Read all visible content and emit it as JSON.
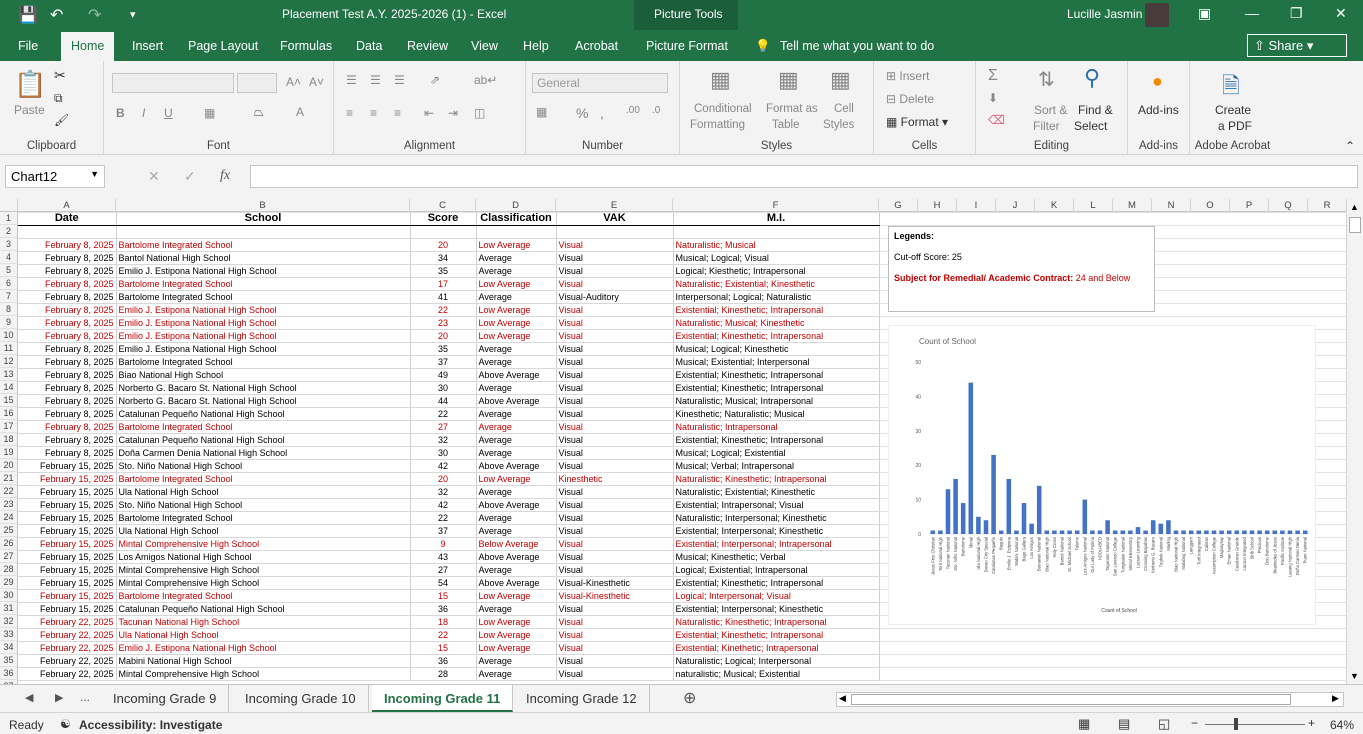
{
  "window": {
    "title": "Placement Test A.Y. 2025-2026 (1)  -  Excel",
    "context_tab": "Picture Tools",
    "user": "Lucille Jasmin"
  },
  "ribbon_tabs": [
    "File",
    "Home",
    "Insert",
    "Page Layout",
    "Formulas",
    "Data",
    "Review",
    "View",
    "Help",
    "Acrobat",
    "Picture Format"
  ],
  "tell_me": "Tell me what you want to do",
  "share_label": "Share",
  "ribbon": {
    "clipboard": {
      "label": "Clipboard",
      "paste": "Paste"
    },
    "font": {
      "label": "Font"
    },
    "alignment": {
      "label": "Alignment"
    },
    "number": {
      "label": "Number",
      "format": "General"
    },
    "styles": {
      "label": "Styles",
      "conditional": "Conditional",
      "formatting": "Formatting",
      "format_as": "Format as",
      "table": "Table",
      "cell": "Cell",
      "cell_styles": "Styles"
    },
    "cells": {
      "label": "Cells",
      "insert": "Insert",
      "delete": "Delete",
      "format": "Format"
    },
    "editing": {
      "label": "Editing",
      "sort": "Sort &",
      "filter": "Filter",
      "find": "Find &",
      "select": "Select"
    },
    "addins": {
      "label": "Add-ins",
      "btn": "Add-ins"
    },
    "acrobat": {
      "label": "Adobe Acrobat",
      "create": "Create",
      "pdf": "a PDF"
    }
  },
  "formula_bar": {
    "name_box": "Chart12",
    "fx": "fx",
    "value": ""
  },
  "columns": [
    "A",
    "B",
    "C",
    "D",
    "E",
    "F",
    "G",
    "H",
    "I",
    "J",
    "K",
    "L",
    "M",
    "N",
    "O",
    "P",
    "Q",
    "R"
  ],
  "headers": [
    "Date",
    "School",
    "Score",
    "Classification",
    "VAK",
    "M.I."
  ],
  "rows": [
    {
      "n": 3,
      "red": true,
      "d": "February 8, 2025",
      "s": "Bartolome Integrated School",
      "sc": "20",
      "c": "Low Average",
      "v": "Visual",
      "m": "Naturalistic; Musical"
    },
    {
      "n": 4,
      "red": false,
      "d": "February 8, 2025",
      "s": "Bantol National High School",
      "sc": "34",
      "c": "Average",
      "v": "Visual",
      "m": "Musical; Logical; Visual"
    },
    {
      "n": 5,
      "red": false,
      "d": "February 8, 2025",
      "s": "Emilio J. Estipona National High School",
      "sc": "35",
      "c": "Average",
      "v": "Visual",
      "m": "Logical; Kiesthetic; Intrapersonal"
    },
    {
      "n": 6,
      "red": true,
      "d": "February 8, 2025",
      "s": "Bartolome Integrated School",
      "sc": "17",
      "c": "Low Average",
      "v": "Visual",
      "m": "Naturalistic; Existential; Kinesthetic"
    },
    {
      "n": 7,
      "red": false,
      "d": "February 8, 2025",
      "s": "Bartolome Integrated School",
      "sc": "41",
      "c": "Average",
      "v": "Visual-Auditory",
      "m": "Interpersonal; Logical; Naturalistic"
    },
    {
      "n": 8,
      "red": true,
      "d": "February 8, 2025",
      "s": "Emilio J. Estipona National High School",
      "sc": "22",
      "c": "Low Average",
      "v": "Visual",
      "m": "Existential; Kinesthetic; Intrapersonal"
    },
    {
      "n": 9,
      "red": true,
      "d": "February 8, 2025",
      "s": "Emilio J. Estipona National High School",
      "sc": "23",
      "c": "Low Average",
      "v": "Visual",
      "m": "Naturalistic; Musical; Kinesthetic"
    },
    {
      "n": 10,
      "red": true,
      "d": "February 8, 2025",
      "s": "Emilio J. Estipona National High School",
      "sc": "20",
      "c": "Low Average",
      "v": "Visual",
      "m": "Existential; Kinesthetic; Intrapersonal"
    },
    {
      "n": 11,
      "red": false,
      "d": "February 8, 2025",
      "s": "Emilio J. Estipona National High School",
      "sc": "35",
      "c": "Average",
      "v": "Visual",
      "m": "Musical; Logical; Kinesthetic"
    },
    {
      "n": 12,
      "red": false,
      "d": "February 8, 2025",
      "s": "Bartolome Integrated School",
      "sc": "37",
      "c": "Average",
      "v": "Visual",
      "m": "Musical; Existential; Interpersonal"
    },
    {
      "n": 13,
      "red": false,
      "d": "February 8, 2025",
      "s": "Biao National High School",
      "sc": "49",
      "c": "Above Average",
      "v": "Visual",
      "m": "Existential; Kinesthetic; Intrapersonal"
    },
    {
      "n": 14,
      "red": false,
      "d": "February 8, 2025",
      "s": "Norberto G. Bacaro St. National High School",
      "sc": "30",
      "c": "Average",
      "v": "Visual",
      "m": "Existential; Kinesthetic; Intrapersonal"
    },
    {
      "n": 15,
      "red": false,
      "d": "February 8, 2025",
      "s": "Norberto G. Bacaro St. National High School",
      "sc": "44",
      "c": "Above Average",
      "v": "Visual",
      "m": "Naturalistic; Musical; Intrapersonal"
    },
    {
      "n": 16,
      "red": false,
      "d": "February 8, 2025",
      "s": "Catalunan Pequeño National High School",
      "sc": "22",
      "c": "Average",
      "v": "Visual",
      "m": "Kinesthetic; Naturalistic; Musical"
    },
    {
      "n": 17,
      "red": true,
      "d": "February 8, 2025",
      "s": "Bartolome Integrated School",
      "sc": "27",
      "c": "Average",
      "v": "Visual",
      "m": "Naturalistic; Intrapersonal"
    },
    {
      "n": 18,
      "red": false,
      "d": "February 8, 2025",
      "s": "Catalunan Pequeño National High School",
      "sc": "32",
      "c": "Average",
      "v": "Visual",
      "m": "Existential; Kinesthetic; Intrapersonal"
    },
    {
      "n": 19,
      "red": false,
      "d": "February 8, 2025",
      "s": "Doña Carmen Denia National High School",
      "sc": "30",
      "c": "Average",
      "v": "Visual",
      "m": "Musical; Logical; Existential"
    },
    {
      "n": 20,
      "red": false,
      "d": "February 15, 2025",
      "s": "Sto. Niño National High School",
      "sc": "42",
      "c": "Above Average",
      "v": "Visual",
      "m": "Musical; Verbal; Intrapersonal"
    },
    {
      "n": 21,
      "red": true,
      "d": "February 15, 2025",
      "s": "Bartolome Integrated School",
      "sc": "20",
      "c": "Low Average",
      "v": "Kinesthetic",
      "m": "Naturalistic; Kinesthetic; Intrapersonal"
    },
    {
      "n": 22,
      "red": false,
      "d": "February 15, 2025",
      "s": "Ula National High School",
      "sc": "32",
      "c": "Average",
      "v": "Visual",
      "m": "Naturalistic; Existential; Kinesthetic"
    },
    {
      "n": 23,
      "red": false,
      "d": "February 15, 2025",
      "s": "Sto. Niño National High School",
      "sc": "42",
      "c": "Above Average",
      "v": "Visual",
      "m": "Existential; Intrapersonal; Visual"
    },
    {
      "n": 24,
      "red": false,
      "d": "February 15, 2025",
      "s": "Bartolome Integrated School",
      "sc": "22",
      "c": "Average",
      "v": "Visual",
      "m": "Naturalistic; Interpersonal; Kinesthetic"
    },
    {
      "n": 25,
      "red": false,
      "d": "February 15, 2025",
      "s": "Ula National High School",
      "sc": "37",
      "c": "Average",
      "v": "Visual",
      "m": "Existential; Interpersonal; Kinesthetic"
    },
    {
      "n": 26,
      "red": true,
      "d": "February 15, 2025",
      "s": "Mintal Comprehensive High School",
      "sc": "9",
      "c": "Below Average",
      "v": "Visual",
      "m": "Existential; Interpersonal; Intrapersonal"
    },
    {
      "n": 27,
      "red": false,
      "d": "February 15, 2025",
      "s": "Los Amigos National High School",
      "sc": "43",
      "c": "Above Average",
      "v": "Visual",
      "m": "Musical; Kinesthetic; Verbal"
    },
    {
      "n": 28,
      "red": false,
      "d": "February 15, 2025",
      "s": "Mintal Comprehensive High School",
      "sc": "27",
      "c": "Average",
      "v": "Visual",
      "m": "Logical; Existential; Intrapersonal"
    },
    {
      "n": 29,
      "red": false,
      "d": "February 15, 2025",
      "s": "Mintal Comprehensive High School",
      "sc": "54",
      "c": "Above Average",
      "v": "Visual-Kinesthetic",
      "m": "Existential; Kinesthetic; Intrapersonal"
    },
    {
      "n": 30,
      "red": true,
      "d": "February 15, 2025",
      "s": "Bartolome Integrated School",
      "sc": "15",
      "c": "Low Average",
      "v": "Visual-Kinesthetic",
      "m": "Logical; Interpersonal; Visual"
    },
    {
      "n": 31,
      "red": false,
      "d": "February 15, 2025",
      "s": "Catalunan Pequeño National High School",
      "sc": "36",
      "c": "Average",
      "v": "Visual",
      "m": "Existential; Interpersonal; Kinesthetic"
    },
    {
      "n": 32,
      "red": true,
      "d": "February 22, 2025",
      "s": "Tacunan National High School",
      "sc": "18",
      "c": "Low Average",
      "v": "Visual",
      "m": "Naturalistic; Kinesthetic; Intrapersonal"
    },
    {
      "n": 33,
      "red": true,
      "d": "February 22, 2025",
      "s": "Ula National High School",
      "sc": "22",
      "c": "Low Average",
      "v": "Visual",
      "m": "Existential; Kinesthetic; Intrapersonal"
    },
    {
      "n": 34,
      "red": true,
      "d": "February 22, 2025",
      "s": "Emilio J. Estipona National High School",
      "sc": "15",
      "c": "Low Average",
      "v": "Visual",
      "m": "Existential; Kinethetic; Intrapersonal"
    },
    {
      "n": 35,
      "red": false,
      "d": "February 22, 2025",
      "s": "Mabini National High School",
      "sc": "36",
      "c": "Average",
      "v": "Visual",
      "m": "Naturalistic; Logical; Interpersonal"
    },
    {
      "n": 36,
      "red": false,
      "d": "February 22, 2025",
      "s": "Mintal Comprehensive High School",
      "sc": "28",
      "c": "Average",
      "v": "Visual",
      "m": "naturalistic; Musical; Existential"
    }
  ],
  "legend": {
    "title": "Legends:",
    "cutoff": "Cut-off Score: 25",
    "remedial_label": "Subject for Remedial/ Academic Contract:",
    "remedial_value": "24 and Below"
  },
  "chart_data": {
    "type": "bar",
    "title": "Count of School",
    "xlabel": "Count of School",
    "ylabel": "",
    "ylim": [
      0,
      50
    ],
    "yticks": [
      0,
      10,
      20,
      30,
      40,
      50
    ],
    "color": "#4472c4",
    "categories": [
      "Jesus First Christian",
      "Toril National High",
      "Tacunan National",
      "Sto. Niño National",
      "Bartolome",
      "Mintal",
      "Ula National High",
      "Davao City Special",
      "Catalunan Pequeño",
      "Baguio",
      "Emilio J. Estipona",
      "Mabini National",
      "Bago Gallera",
      "Los Amigos",
      "Bunawan National",
      "Biao National High",
      "Holy Cross",
      "Bantol National",
      "St. Michael School",
      "Talomo",
      "Los Amigos National",
      "Our Lady of Fatima",
      "NDDU-IBED",
      "Tagurano National",
      "San Lorenzo College",
      "Tungkalan National",
      "Mintal Elementary",
      "Lacson Learning",
      "Crossing Bayabas",
      "Norberto G. Bacaro",
      "Tugbok National",
      "Marilog",
      "Biao National High",
      "Malabog National",
      "Langgam",
      "Toril Integrated",
      "Calinan",
      "Assumption College",
      "Magsaysay",
      "Eman National",
      "Catalunan Grande",
      "Lacson Integrated",
      "Sirib School",
      "Precious",
      "Don Bartolome",
      "Beatitudes of Jesus",
      "Pacific Institute",
      "Lasang National High",
      "Doña Carmen Denia",
      "Puan National"
    ],
    "values": [
      1,
      1,
      13,
      16,
      9,
      44,
      5,
      4,
      23,
      1,
      16,
      1,
      9,
      3,
      14,
      1,
      1,
      1,
      1,
      1,
      10,
      1,
      1,
      4,
      1,
      1,
      1,
      2,
      1,
      4,
      3,
      4,
      1,
      1,
      1,
      1,
      1,
      1,
      1,
      1,
      1,
      1,
      1,
      1,
      1,
      1,
      1,
      1,
      1,
      1
    ]
  },
  "sheet_tabs": [
    "Incoming Grade 9",
    "Incoming Grade 10",
    "Incoming Grade 11",
    "Incoming Grade 12"
  ],
  "active_sheet": "Incoming Grade 11",
  "status": {
    "ready": "Ready",
    "accessibility": "Accessibility: Investigate",
    "zoom": "64%"
  }
}
